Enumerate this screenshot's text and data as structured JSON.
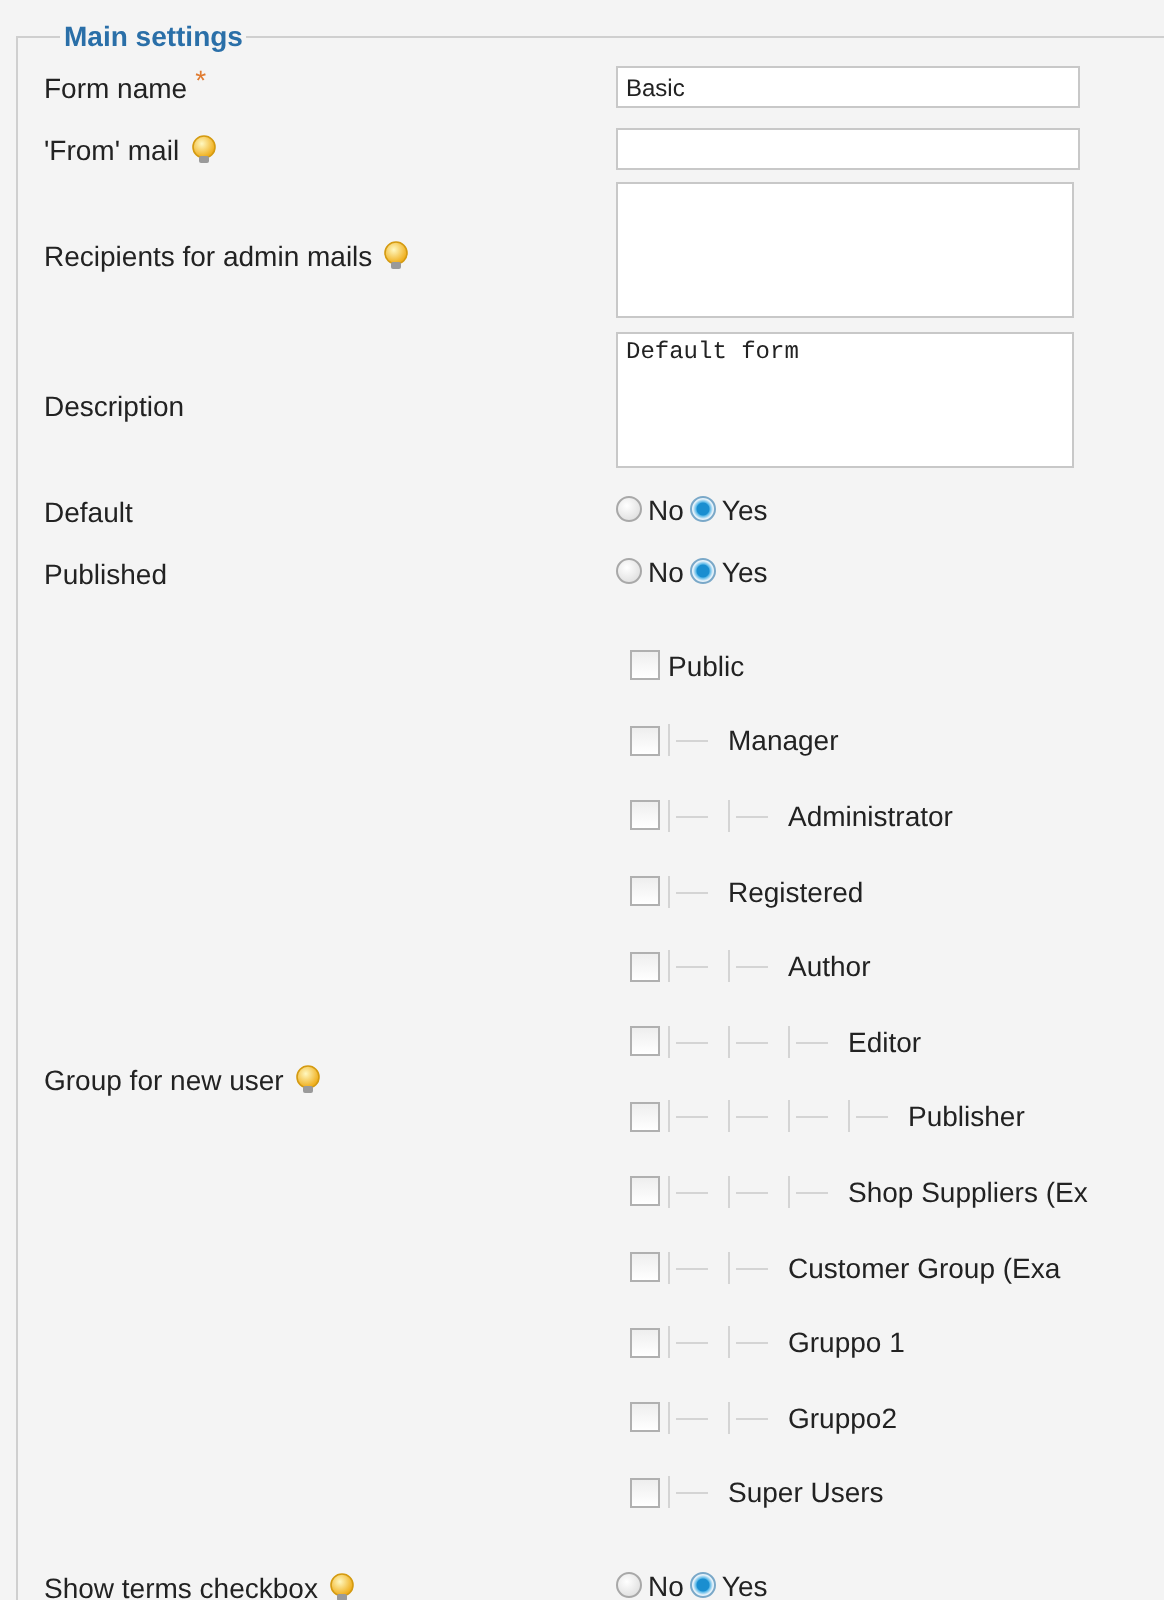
{
  "section_title": "Main settings",
  "fields": [
    {
      "kind": "text",
      "label": "Form name",
      "required_mark": "*",
      "value": "Basic"
    },
    {
      "kind": "text",
      "label": "'From' mail",
      "hint": true
    },
    {
      "kind": "textarea",
      "label": "Recipients for admin mails",
      "hint": true
    },
    {
      "kind": "textarea",
      "label": "Description",
      "value": "Default form"
    },
    {
      "kind": "radio",
      "label": "Default",
      "options": [
        {
          "label": "No",
          "selected": false
        },
        {
          "label": "Yes",
          "selected": true
        }
      ]
    },
    {
      "kind": "radio",
      "label": "Published",
      "options": [
        {
          "label": "No",
          "selected": false
        },
        {
          "label": "Yes",
          "selected": true
        }
      ]
    },
    {
      "kind": "tree",
      "label": "Group for new user",
      "hint": true,
      "items": [
        {
          "label": "Public",
          "checked": false,
          "children": [
            {
              "label": "Manager",
              "checked": false,
              "children": [
                {
                  "label": "Administrator",
                  "checked": false
                }
              ]
            },
            {
              "label": "Registered",
              "checked": false,
              "children": [
                {
                  "label": "Author",
                  "checked": false,
                  "children": [
                    {
                      "label": "Editor",
                      "checked": false,
                      "children": [
                        {
                          "label": "Publisher",
                          "checked": false
                        }
                      ]
                    },
                    {
                      "label": "Shop Suppliers (Ex",
                      "checked": false
                    }
                  ]
                },
                {
                  "label": "Customer Group (Exa",
                  "checked": false
                },
                {
                  "label": "Gruppo 1",
                  "checked": false
                },
                {
                  "label": "Gruppo2",
                  "checked": false
                }
              ]
            },
            {
              "label": "Super Users",
              "checked": false
            }
          ]
        }
      ]
    },
    {
      "kind": "radio",
      "label": "Show terms checkbox",
      "hint": true,
      "options": [
        {
          "label": "No",
          "selected": false
        },
        {
          "label": "Yes",
          "selected": true
        }
      ]
    }
  ]
}
